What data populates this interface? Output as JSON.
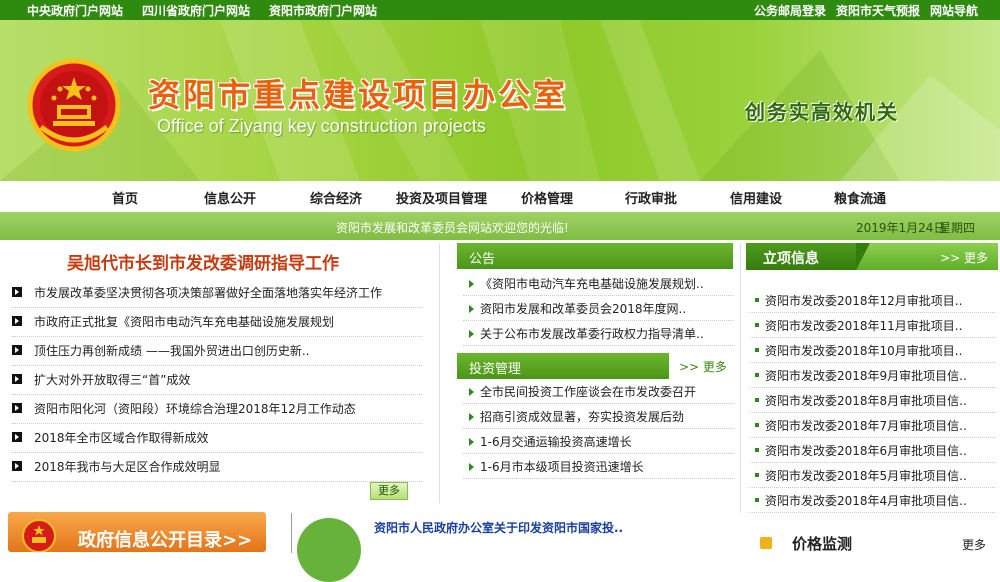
{
  "topbar": {
    "left_links": [
      "中央政府门户网站",
      "四川省政府门户网站",
      "资阳市政府门户网站"
    ],
    "right_links": [
      "公务邮局登录",
      "资阳市天气预报",
      "网站导航"
    ]
  },
  "banner": {
    "title": "资阳市重点建设项目办公室",
    "subtitle": "Office of Ziyang key construction projects",
    "slogan": "创务实高效机关",
    "emblem_icon": "national-emblem-icon"
  },
  "nav": {
    "items": [
      "首页",
      "信息公开",
      "综合经济",
      "投资及项目管理",
      "价格管理",
      "行政审批",
      "信用建设",
      "粮食流通"
    ]
  },
  "welcome": {
    "text": "资阳市发展和改革委员会网站欢迎您的光临!",
    "date": "2019年1月24日",
    "weekday": "星期四"
  },
  "left": {
    "headline": "吴旭代市长到市发改委调研指导工作",
    "news": [
      "市发展改革委坚决贯彻各项决策部署做好全面落地落实年经济工作",
      "市政府正式批复《资阳市电动汽车充电基础设施发展规划",
      "顶住压力再创新成绩 ——我国外贸进出口创历史新..",
      "扩大对外开放取得三“首”成效",
      "资阳市阳化河（资阳段）环境综合治理2018年12月工作动态",
      "2018年全市区域合作取得新成效",
      "2018年我市与大足区合作成效明显"
    ],
    "more_label": "更多",
    "gov_banner_text": "政府信息公开目录>>"
  },
  "middle": {
    "notice": {
      "title": "公告",
      "items": [
        "《资阳市电动汽车充电基础设施发展规划..",
        "资阳市发展和改革委员会2018年度网..",
        "关于公布市发展改革委行政权力指导清单.."
      ]
    },
    "investment": {
      "title": "投资管理",
      "more_label": ">> 更多",
      "items": [
        "全市民间投资工作座谈会在市发改委召开",
        "招商引资成效显著，夯实投资发展后劲",
        "1-6月交通运输投资高速增长",
        "1-6月市本级项目投资迅速增长"
      ]
    },
    "bottom_link": "资阳市人民政府办公室关于印发资阳市国家投.."
  },
  "right": {
    "title": "立项信息",
    "more_label": ">> 更多",
    "items": [
      "资阳市发改委2018年12月审批项目..",
      "资阳市发改委2018年11月审批项目..",
      "资阳市发改委2018年10月审批项目..",
      "资阳市发改委2018年9月审批项目信..",
      "资阳市发改委2018年8月审批项目信..",
      "资阳市发改委2018年7月审批项目信..",
      "资阳市发改委2018年6月审批项目信..",
      "资阳市发改委2018年5月审批项目信..",
      "资阳市发改委2018年4月审批项目信.."
    ],
    "price_title": "价格监测",
    "price_more": "更多"
  },
  "colors": {
    "topbar": "#2f8a10",
    "accent_green": "#5fae28",
    "title_orange": "#e8620c",
    "headline_red": "#c53c10",
    "link_blue": "#1b3f9e"
  }
}
